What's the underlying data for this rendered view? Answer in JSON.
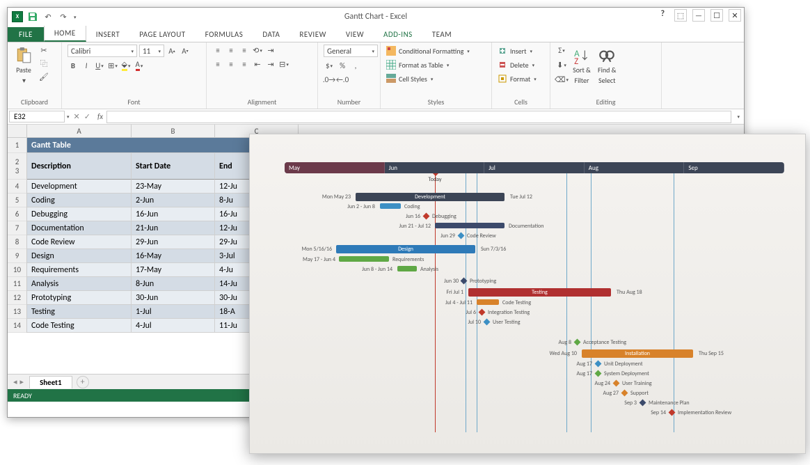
{
  "window": {
    "title": "Gantt Chart - Excel"
  },
  "qat": [
    "save-icon",
    "undo-icon",
    "redo-icon"
  ],
  "tabs": {
    "file": "FILE",
    "home": "HOME",
    "insert": "INSERT",
    "pageLayout": "PAGE LAYOUT",
    "formulas": "FORMULAS",
    "data": "DATA",
    "review": "REVIEW",
    "view": "VIEW",
    "addins": "ADD-INS",
    "team": "TEAM"
  },
  "ribbon": {
    "clipboard": {
      "label": "Clipboard",
      "paste": "Paste"
    },
    "font": {
      "label": "Font",
      "family": "Calibri",
      "size": "11"
    },
    "alignment": {
      "label": "Alignment"
    },
    "number": {
      "label": "Number",
      "format": "General"
    },
    "styles": {
      "label": "Styles",
      "cond": "Conditional Formatting",
      "table": "Format as Table",
      "cell": "Cell Styles"
    },
    "cells": {
      "label": "Cells",
      "insert": "Insert",
      "delete": "Delete",
      "format": "Format"
    },
    "editing": {
      "label": "Editing",
      "sort": "Sort &",
      "filter": "Filter",
      "find": "Find &",
      "select": "Select"
    }
  },
  "nameBox": "E32",
  "columns": [
    "A",
    "B",
    "C"
  ],
  "table": {
    "title": "Gantt Table",
    "headers": {
      "desc": "Description",
      "start": "Start Date",
      "end": "End"
    },
    "rows": [
      {
        "n": "4",
        "desc": "Development",
        "start": "23-May",
        "end": "12-Ju"
      },
      {
        "n": "5",
        "desc": "Coding",
        "start": "2-Jun",
        "end": "8-Ju"
      },
      {
        "n": "6",
        "desc": "Debugging",
        "start": "16-Jun",
        "end": "16-Ju"
      },
      {
        "n": "7",
        "desc": "Documentation",
        "start": "21-Jun",
        "end": "12-Ju"
      },
      {
        "n": "8",
        "desc": "Code Review",
        "start": "29-Jun",
        "end": "29-Ju"
      },
      {
        "n": "9",
        "desc": "Design",
        "start": "16-May",
        "end": "3-Jul"
      },
      {
        "n": "10",
        "desc": "Requirements",
        "start": "17-May",
        "end": "4-Ju"
      },
      {
        "n": "11",
        "desc": "Analysis",
        "start": "8-Jun",
        "end": "14-Ju"
      },
      {
        "n": "12",
        "desc": "Prototyping",
        "start": "30-Jun",
        "end": "30-Ju"
      },
      {
        "n": "13",
        "desc": "Testing",
        "start": "1-Jul",
        "end": "18-A"
      },
      {
        "n": "14",
        "desc": "Code Testing",
        "start": "4-Jul",
        "end": "11-Ju"
      }
    ]
  },
  "sheetTab": "Sheet1",
  "status": "READY",
  "gantt": {
    "months": [
      "May",
      "Jun",
      "Jul",
      "Aug",
      "Sep"
    ],
    "today": "Today",
    "items": {
      "devLeft": "Mon May 23",
      "devRight": "Tue Jul 12",
      "devLabel": "Development",
      "codingLeft": "Jun 2 - Jun 8",
      "codingLabel": "Coding",
      "debugLeft": "Jun 16",
      "debugLabel": "Debugging",
      "docLeft": "Jun 21 - Jul 12",
      "docLabel": "Documentation",
      "crLeft": "Jun 29",
      "crLabel": "Code Review",
      "designLeft": "Mon 5/16/16",
      "designRight": "Sun 7/3/16",
      "designLabel": "Design",
      "reqLeft": "May 17 - Jun 4",
      "reqLabel": "Requirements",
      "anaLeft": "Jun 8 - Jun 14",
      "anaLabel": "Analysis",
      "protoLeft": "Jun 30",
      "protoLabel": "Prototyping",
      "testLeft": "Fri Jul 1",
      "testRight": "Thu Aug 18",
      "testLabel": "Testing",
      "ctLeft": "Jul 4 - Jul 11",
      "ctLabel": "Code Testing",
      "itLeft": "Jul 6",
      "itLabel": "Integration Testing",
      "utLeft": "Jul 10",
      "utLabel": "User Testing",
      "atLeft": "Aug 8",
      "atLabel": "Acceptance Testing",
      "instLeft": "Wed Aug 10",
      "instRight": "Thu Sep 15",
      "instLabel": "Installation",
      "udLeft": "Aug 17",
      "udLabel": "Unit Deployment",
      "sdLeft": "Aug 17",
      "sdLabel": "System Deployment",
      "utrLeft": "Aug 24",
      "utrLabel": "User Training",
      "supLeft": "Aug 27",
      "supLabel": "Support",
      "mpLeft": "Sep 3",
      "mpLabel": "Maintenance Plan",
      "irLeft": "Sep 14",
      "irLabel": "Implementation Review"
    }
  }
}
